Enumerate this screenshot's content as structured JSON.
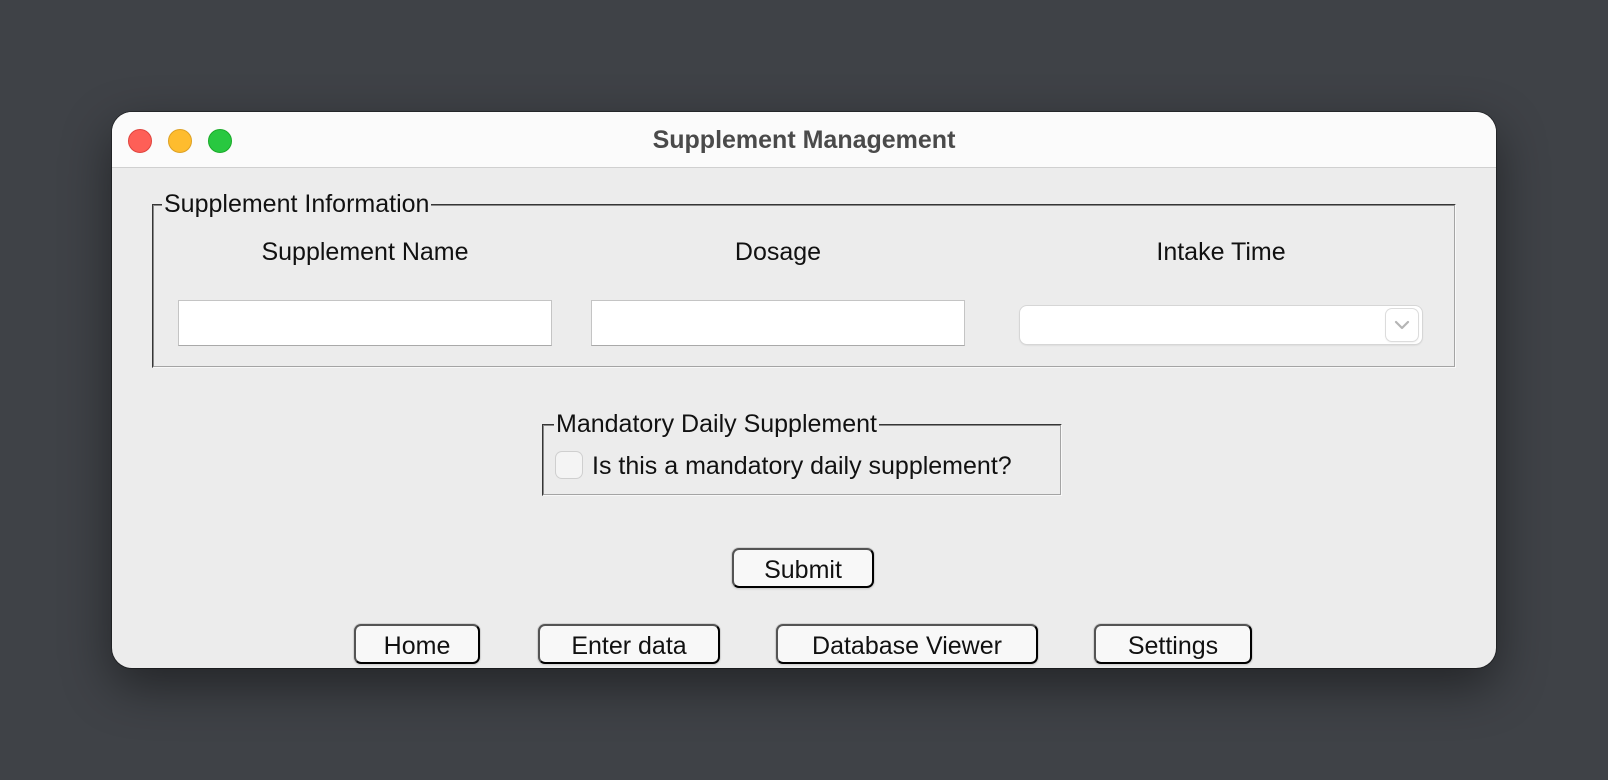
{
  "window": {
    "title": "Supplement Management"
  },
  "supplement_info": {
    "legend": "Supplement Information",
    "name_label": "Supplement Name",
    "name_value": "",
    "dosage_label": "Dosage",
    "dosage_value": "",
    "intake_label": "Intake Time",
    "intake_value": ""
  },
  "mandatory": {
    "legend": "Mandatory Daily Supplement",
    "checkbox_label": "Is this a mandatory daily supplement?",
    "checked": false
  },
  "actions": {
    "submit_label": "Submit"
  },
  "nav": {
    "home_label": "Home",
    "enter_label": "Enter data",
    "db_label": "Database Viewer",
    "settings_label": "Settings"
  },
  "colors": {
    "close": "#fe5f57",
    "minimize": "#febc2e",
    "maximize": "#28c840",
    "window_bg": "#ececec",
    "desktop_bg": "#3f4247"
  },
  "icons": {
    "intake_dropdown": "chevron-down-icon"
  }
}
